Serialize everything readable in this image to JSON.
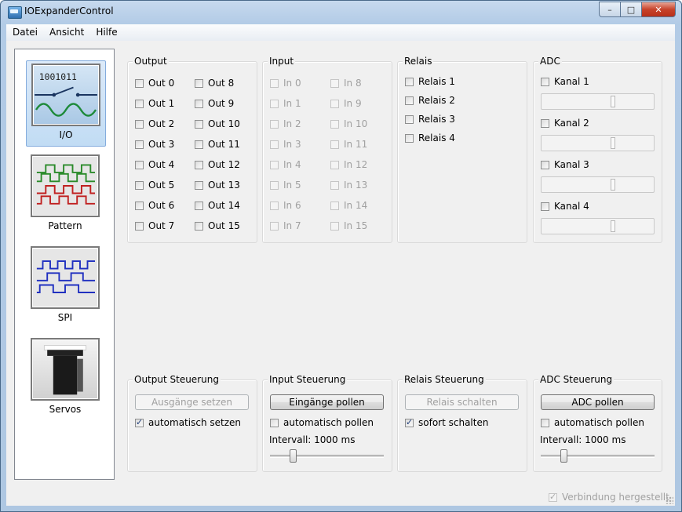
{
  "window": {
    "title": "IOExpanderControl",
    "minimize": "–",
    "maximize": "□",
    "close": "✕"
  },
  "menu": [
    "Datei",
    "Ansicht",
    "Hilfe"
  ],
  "sidebar": [
    {
      "label": "I/O",
      "icon": "io-switch-icon",
      "selected": true,
      "digits": "1001011"
    },
    {
      "label": "Pattern",
      "icon": "pattern-waveform-icon",
      "selected": false
    },
    {
      "label": "SPI",
      "icon": "spi-waveform-icon",
      "selected": false
    },
    {
      "label": "Servos",
      "icon": "servo-icon",
      "selected": false
    }
  ],
  "output": {
    "title": "Output",
    "col1": [
      "Out 0",
      "Out 1",
      "Out 2",
      "Out 3",
      "Out 4",
      "Out 5",
      "Out 6",
      "Out 7"
    ],
    "col2": [
      "Out 8",
      "Out 9",
      "Out 10",
      "Out 11",
      "Out 12",
      "Out 13",
      "Out 14",
      "Out 15"
    ]
  },
  "input": {
    "title": "Input",
    "col1": [
      "In 0",
      "In 1",
      "In 2",
      "In 3",
      "In 4",
      "In 5",
      "In 6",
      "In 7"
    ],
    "col2": [
      "In 8",
      "In 9",
      "In 10",
      "In 11",
      "In 12",
      "In 13",
      "In 14",
      "In 15"
    ]
  },
  "relais": {
    "title": "Relais",
    "items": [
      "Relais 1",
      "Relais 2",
      "Relais 3",
      "Relais 4"
    ]
  },
  "adc": {
    "title": "ADC",
    "channels": [
      "Kanal 1",
      "Kanal 2",
      "Kanal 3",
      "Kanal 4"
    ]
  },
  "output_ctrl": {
    "title": "Output Steuerung",
    "button": "Ausgänge setzen",
    "checkbox": "automatisch setzen"
  },
  "input_ctrl": {
    "title": "Input Steuerung",
    "button": "Eingänge pollen",
    "checkbox": "automatisch pollen",
    "interval": "Intervall: 1000 ms"
  },
  "relais_ctrl": {
    "title": "Relais Steuerung",
    "button": "Relais schalten",
    "checkbox": "sofort schalten"
  },
  "adc_ctrl": {
    "title": "ADC Steuerung",
    "button": "ADC pollen",
    "checkbox": "automatisch pollen",
    "interval": "Intervall: 1000 ms"
  },
  "status": {
    "connection": "Verbindung hergestellt"
  }
}
